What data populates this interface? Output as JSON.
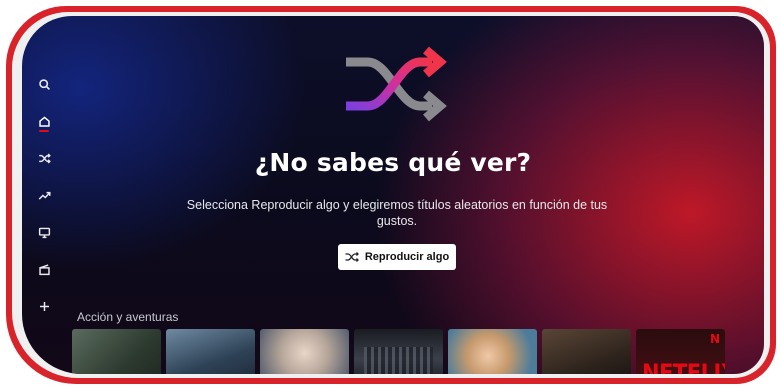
{
  "sidebar": {
    "items": [
      {
        "icon": "search-icon"
      },
      {
        "icon": "home-icon",
        "active": true
      },
      {
        "icon": "shuffle-icon"
      },
      {
        "icon": "trending-icon"
      },
      {
        "icon": "tv-icon"
      },
      {
        "icon": "movies-icon"
      },
      {
        "icon": "plus-icon"
      }
    ]
  },
  "hero": {
    "icon": "shuffle-icon",
    "headline": "¿No sabes qué ver?",
    "subtext": "Selecciona Reproducir algo y elegiremos títulos aleatorios en función de tus gustos.",
    "button_label": "Reproducir algo",
    "button_icon": "shuffle-icon"
  },
  "row": {
    "title": "Acción y aventuras",
    "thumbnails": [
      {
        "label": ""
      },
      {
        "label": ""
      },
      {
        "label": ""
      },
      {
        "label": ""
      },
      {
        "label": ""
      },
      {
        "label": ""
      },
      {
        "label": "NETFLIX",
        "badge": "N"
      }
    ]
  },
  "colors": {
    "accent": "#e50914",
    "frame": "#d8232a",
    "background": "#0b0a1c"
  }
}
